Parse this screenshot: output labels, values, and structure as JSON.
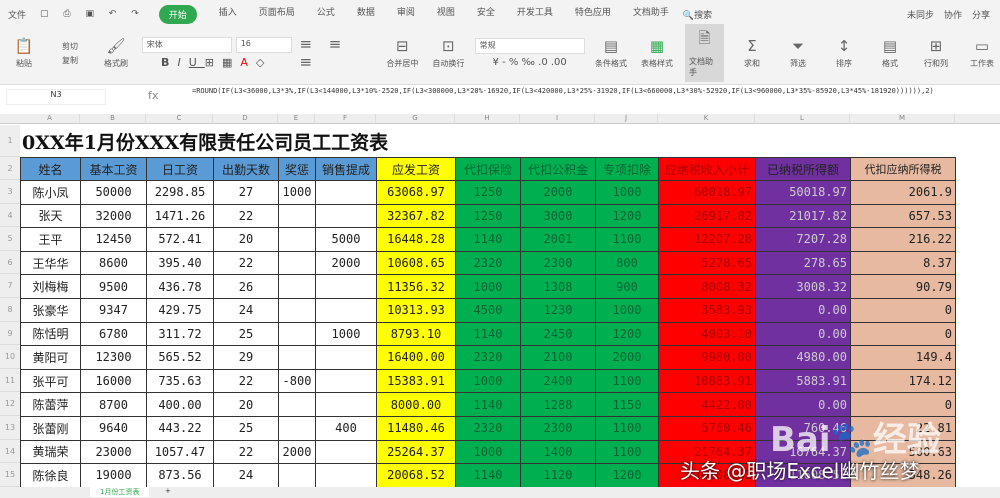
{
  "menu": {
    "file": "文件",
    "tabs": [
      "开始",
      "插入",
      "页面布局",
      "公式",
      "数据",
      "审阅",
      "视图",
      "安全",
      "开发工具",
      "特色应用",
      "文档助手"
    ],
    "search": "搜索",
    "right": [
      "未同步",
      "协作",
      "分享"
    ]
  },
  "ribbon": {
    "paste": "粘贴",
    "cut": "剪切",
    "copy": "复制",
    "format_painter": "格式刷",
    "font": "宋体",
    "size": "16",
    "merge": "合并居中",
    "wrap": "自动换行",
    "number_format": "常规",
    "cond_format": "条件格式",
    "table_style": "表格样式",
    "doc_helper": "文档助手",
    "sum": "求和",
    "filter": "筛选",
    "sort": "排序",
    "format": "格式",
    "row_col": "行和列",
    "worksheet": "工作表"
  },
  "formula_bar": {
    "name_box": "N3",
    "fx": "fx",
    "formula": "=ROUND(IF(L3<36000,L3*3%,IF(L3<144000,L3*10%-2520,IF(L3<300000,L3*20%-16920,IF(L3<420000,L3*25%-31920,IF(L3<660000,L3*30%-52920,IF(L3<960000,L3*35%-85920,L3*45%-181920)))))),2)"
  },
  "columns": [
    "A",
    "B",
    "C",
    "D",
    "E",
    "F",
    "G",
    "H",
    "I",
    "J",
    "K",
    "L",
    "M"
  ],
  "title": "0XX年1月份XXX有限责任公司员工工资表",
  "headers": [
    "姓名",
    "基本工资",
    "日工资",
    "出勤天数",
    "奖惩",
    "销售提成",
    "应发工资",
    "代扣保险",
    "代扣公积金",
    "专项扣除",
    "应纳税收入小计",
    "已纳税所得额",
    "代扣应纳所得税"
  ],
  "rows": [
    [
      "陈小凤",
      "50000",
      "2298.85",
      "27",
      "1000",
      "",
      "63068.97",
      "1250",
      "2000",
      "1000",
      "60018.97",
      "50018.97",
      "2061.9"
    ],
    [
      "张天",
      "32000",
      "1471.26",
      "22",
      "",
      "",
      "32367.82",
      "1250",
      "3000",
      "1200",
      "26917.82",
      "21017.82",
      "657.53"
    ],
    [
      "王平",
      "12450",
      "572.41",
      "20",
      "",
      "5000",
      "16448.28",
      "1140",
      "2001",
      "1100",
      "12207.28",
      "7207.28",
      "216.22"
    ],
    [
      "王华华",
      "8600",
      "395.40",
      "22",
      "",
      "2000",
      "10608.65",
      "2320",
      "2300",
      "800",
      "5278.65",
      "278.65",
      "8.37"
    ],
    [
      "刘梅梅",
      "9500",
      "436.78",
      "26",
      "",
      "",
      "11356.32",
      "1000",
      "1308",
      "900",
      "8008.32",
      "3008.32",
      "90.79"
    ],
    [
      "张豪华",
      "9347",
      "429.75",
      "24",
      "",
      "",
      "10313.93",
      "4500",
      "1230",
      "1000",
      "3583.93",
      "0.00",
      "0"
    ],
    [
      "陈恬明",
      "6780",
      "311.72",
      "25",
      "",
      "1000",
      "8793.10",
      "1140",
      "2450",
      "1200",
      "4003.10",
      "0.00",
      "0"
    ],
    [
      "黄阳可",
      "12300",
      "565.52",
      "29",
      "",
      "",
      "16400.00",
      "2320",
      "2100",
      "2000",
      "9980.00",
      "4980.00",
      "149.4"
    ],
    [
      "张平可",
      "16000",
      "735.63",
      "22",
      "-800",
      "",
      "15383.91",
      "1000",
      "2400",
      "1100",
      "10883.91",
      "5883.91",
      "174.12"
    ],
    [
      "陈蕾萍",
      "8700",
      "400.00",
      "20",
      "",
      "",
      "8000.00",
      "1140",
      "1288",
      "1150",
      "4422.00",
      "0.00",
      "0"
    ],
    [
      "张蕾刚",
      "9640",
      "443.22",
      "25",
      "",
      "400",
      "11480.46",
      "2320",
      "2300",
      "1100",
      "5760.46",
      "760.46",
      "22.81"
    ],
    [
      "黄瑞荣",
      "23000",
      "1057.47",
      "22",
      "2000",
      "",
      "25264.37",
      "1000",
      "1400",
      "1100",
      "21764.37",
      "16764.37",
      "500.63"
    ],
    [
      "陈徐良",
      "19000",
      "873.56",
      "24",
      "",
      "",
      "20068.52",
      "1140",
      "1120",
      "1200",
      "16608.52",
      "11608.52",
      "348.26"
    ]
  ],
  "sheet": {
    "tab": "1月份工资表",
    "add": "+"
  },
  "watermark": {
    "text": "头条 @职场Excel幽竹丝梦",
    "baidu": "Bai 经验"
  },
  "colors": {
    "header_blue": "#5b9bd5",
    "yellow": "#ffff00",
    "green": "#00b050",
    "red": "#ff0000",
    "purple": "#7030a0",
    "peach": "#e6b9a0"
  }
}
